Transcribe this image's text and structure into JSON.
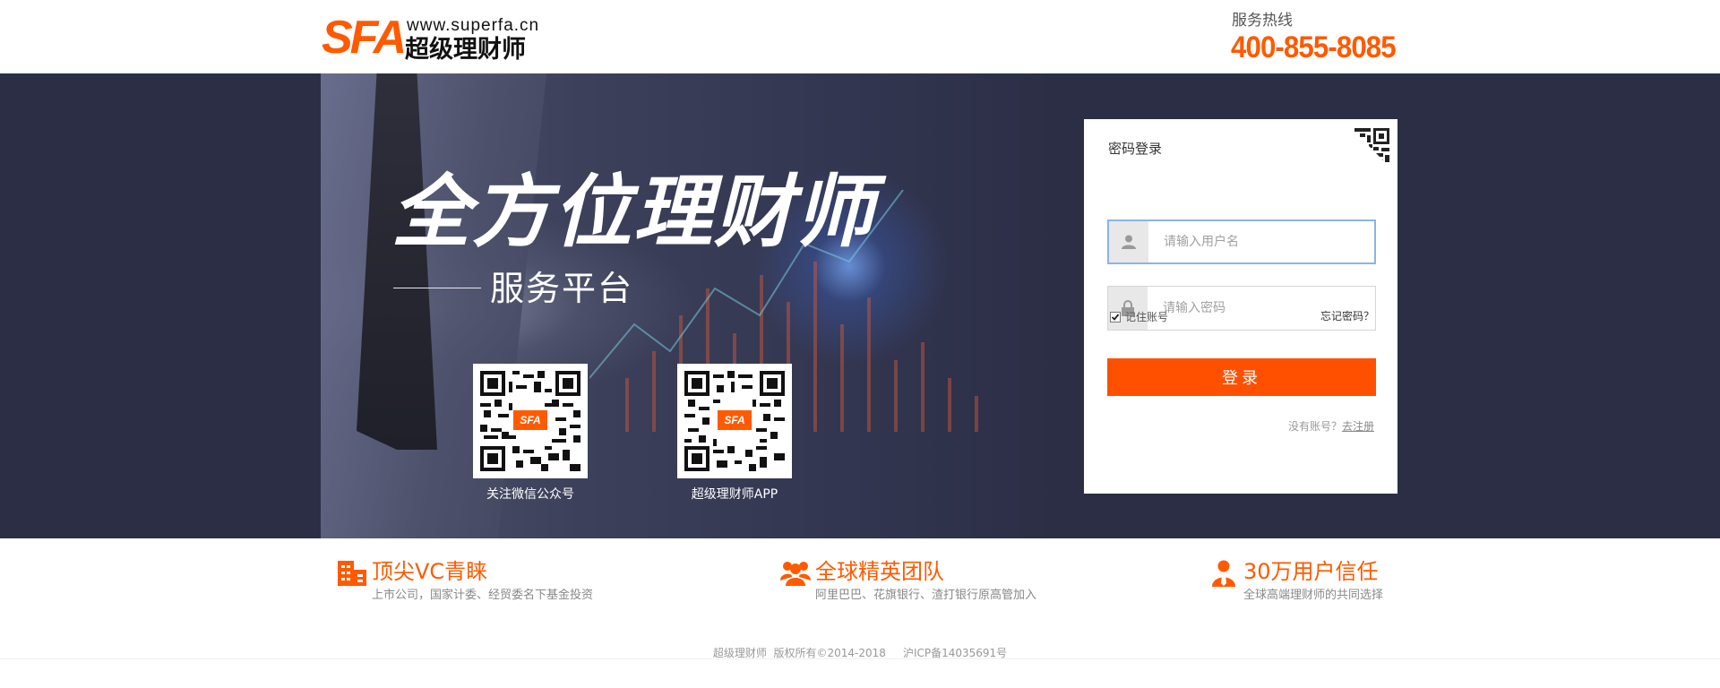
{
  "header": {
    "logo_mark": "SFA",
    "logo_url": "www.superfa.cn",
    "logo_name": "超级理财师",
    "hotline_label": "服务热线",
    "hotline_number": "400-855-8085"
  },
  "banner": {
    "title": "全方位理财师",
    "subtitle": "服务平台",
    "qr_codes": [
      {
        "caption": "关注微信公众号",
        "badge": "SFA"
      },
      {
        "caption": "超级理财师APP",
        "badge": "SFA"
      }
    ]
  },
  "login": {
    "tab_label": "密码登录",
    "username_placeholder": "请输入用户名",
    "password_placeholder": "请输入密码",
    "remember_label": "记住账号",
    "remember_checked": true,
    "forgot_label": "忘记密码？",
    "submit_label": "登录",
    "register_prompt": "没有账号？",
    "register_link": "去注册"
  },
  "features": [
    {
      "icon": "building-icon",
      "title": "顶尖VC青睐",
      "desc": "上市公司，国家计委、经贸委名下基金投资"
    },
    {
      "icon": "team-icon",
      "title": "全球精英团队",
      "desc": "阿里巴巴、花旗银行、渣打银行原高管加入"
    },
    {
      "icon": "user-tie-icon",
      "title": "30万用户信任",
      "desc": "全球高端理财师的共同选择"
    }
  ],
  "footer": {
    "text": "超级理财师  版权所有©2014-2018     沪ICP备14035691号"
  },
  "colors": {
    "accent": "#ff5a00",
    "button": "#ff5000",
    "banner_bg": "#2b2e45",
    "input_focus_border": "#8ab4e8"
  }
}
